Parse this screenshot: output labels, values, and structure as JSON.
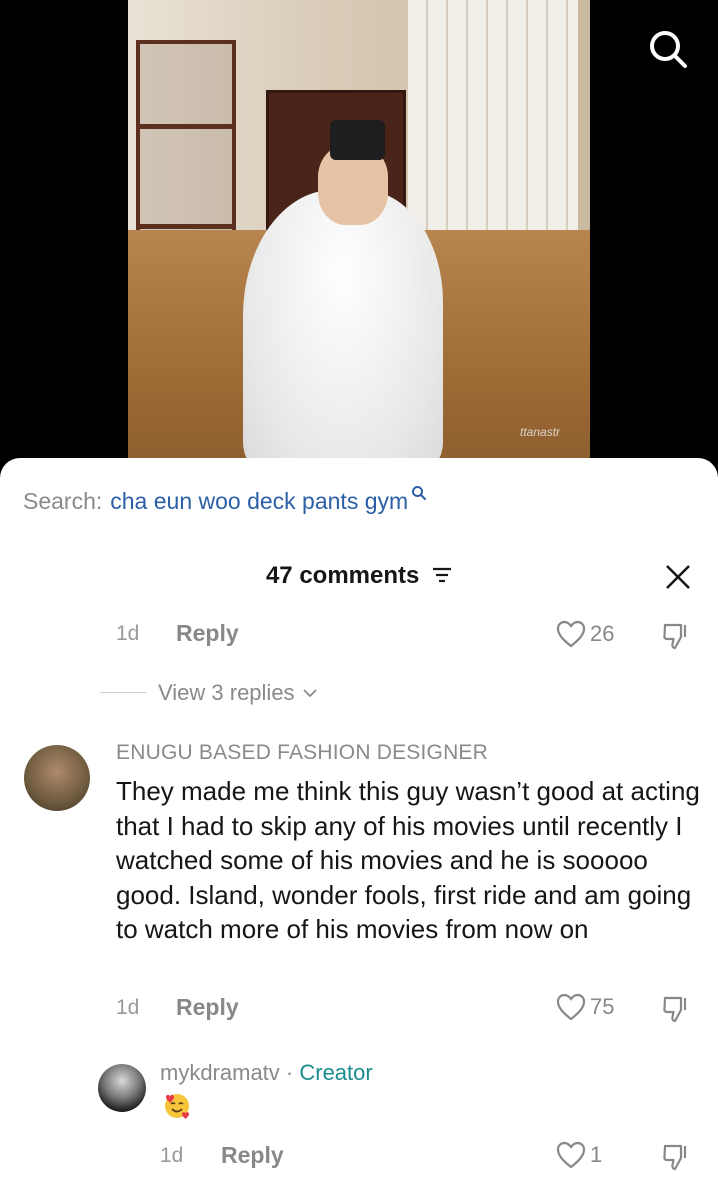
{
  "video": {
    "watermark": "ttanastr"
  },
  "search": {
    "prefix": "Search:",
    "query": "cha eun woo deck pants gym"
  },
  "comments_header": {
    "count_label": "47 comments"
  },
  "comment_previous": {
    "time": "1d",
    "reply": "Reply",
    "likes": "26"
  },
  "view_replies": "View 3 replies",
  "comment_main": {
    "author": "ENUGU BASED FASHION DESIGNER",
    "text": "They made me think this guy wasn’t good at acting that I had to skip any of his movies until recently I watched some of his movies and he is sooooo good. Island, wonder fools, first ride and am going to watch more of his movies from now on",
    "time": "1d",
    "reply": "Reply",
    "likes": "75"
  },
  "creator_reply": {
    "author": "mykdramatv",
    "separator": " · ",
    "badge": "Creator",
    "emoji": "smiling-face-with-hearts",
    "time": "1d",
    "reply": "Reply",
    "likes": "1"
  },
  "colors": {
    "link": "#2b5fa6",
    "creator_badge": "#1b8c8e",
    "muted": "#8a8a8a"
  }
}
